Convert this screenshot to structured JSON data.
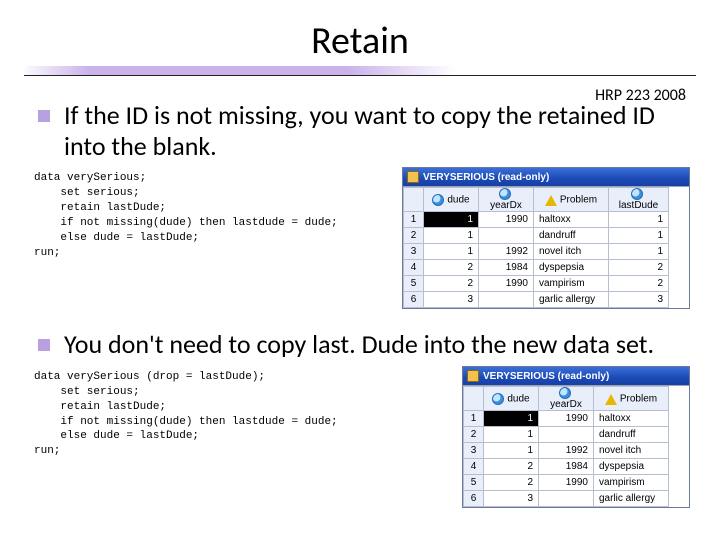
{
  "title": "Retain",
  "course": "HRP 223 2008",
  "bullet1": "If the ID is not missing, you want to copy the retained ID into the blank.",
  "bullet2": "You don't need to copy last. Dude into the new data set.",
  "code1": "data verySerious;\n    set serious;\n    retain lastDude;\n    if not missing(dude) then lastdude = dude;\n    else dude = lastDude;\nrun;",
  "code2": "data verySerious (drop = lastDude);\n    set serious;\n    retain lastDude;\n    if not missing(dude) then lastdude = dude;\n    else dude = lastDude;\nrun;",
  "win1": {
    "title": "VERYSERIOUS (read-only)",
    "cols": [
      "",
      "dude",
      "yearDx",
      "Problem",
      "lastDude"
    ],
    "icons": [
      "",
      "globe",
      "globe",
      "warn",
      "globe"
    ],
    "rows": [
      [
        "1",
        "1",
        "1990",
        "haltoxx",
        "1"
      ],
      [
        "2",
        "1",
        "",
        "dandruff",
        "1"
      ],
      [
        "3",
        "1",
        "1992",
        "novel itch",
        "1"
      ],
      [
        "4",
        "2",
        "1984",
        "dyspepsia",
        "2"
      ],
      [
        "5",
        "2",
        "1990",
        "vampirism",
        "2"
      ],
      [
        "6",
        "3",
        "",
        "garlic allergy",
        "3"
      ]
    ]
  },
  "win2": {
    "title": "VERYSERIOUS (read-only)",
    "cols": [
      "",
      "dude",
      "yearDx",
      "Problem"
    ],
    "icons": [
      "",
      "globe",
      "globe",
      "warn"
    ],
    "rows": [
      [
        "1",
        "1",
        "1990",
        "haltoxx"
      ],
      [
        "2",
        "1",
        "",
        "dandruff"
      ],
      [
        "3",
        "1",
        "1992",
        "novel itch"
      ],
      [
        "4",
        "2",
        "1984",
        "dyspepsia"
      ],
      [
        "5",
        "2",
        "1990",
        "vampirism"
      ],
      [
        "6",
        "3",
        "",
        "garlic allergy"
      ]
    ]
  }
}
